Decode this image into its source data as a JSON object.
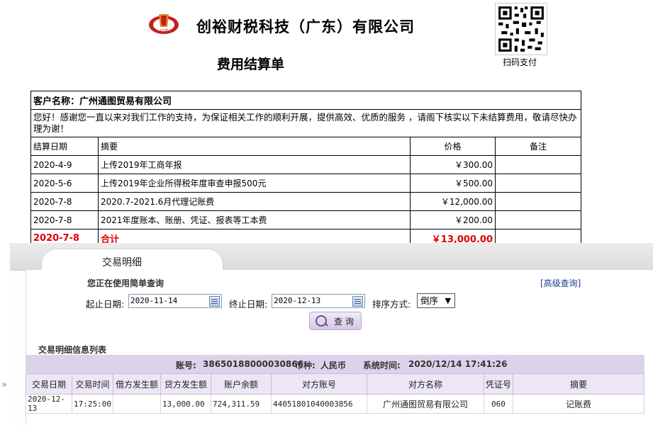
{
  "statement": {
    "company_name": "创裕财税科技（广东）有限公司",
    "doc_title": "费用结算单",
    "qr_label": "扫码支付",
    "customer_label": "客户名称：广州通图贸易有限公司",
    "message": "您好！感谢您一直以来对我们工作的支持，为保证相关工作的顺利开展，提供高效、优质的服务 ，请阁下核实以下未结算费用，敬请尽快办理为谢！",
    "headers": [
      "结算日期",
      "摘要",
      "价格",
      "备注"
    ],
    "rows": [
      {
        "date": "2020-4-9",
        "summary": "上传2019年工商年报",
        "price": "￥300.00",
        "note": ""
      },
      {
        "date": "2020-5-6",
        "summary": "上传2019年企业所得税年度审查申报500元",
        "price": "￥500.00",
        "note": ""
      },
      {
        "date": "2020-7-8",
        "summary": "2020.7-2021.6月代理记账费",
        "price": "￥12,000.00",
        "note": ""
      },
      {
        "date": "2020-7-8",
        "summary": "2021年度账本、账册、凭证、报表等工本费",
        "price": "￥200.00",
        "note": ""
      }
    ],
    "total": {
      "date": "2020-7-8",
      "summary": "合计",
      "price": "￥13,000.00"
    }
  },
  "txn": {
    "tab_label": "交易明细",
    "query_hint": "您正在使用简单查询",
    "advanced_link": "[高级查询]",
    "start_label": "起止日期:",
    "start_value": "2020-11-14",
    "end_label": "终止日期:",
    "end_value": "2020-12-13",
    "sort_label": "排序方式:",
    "sort_value": "倒序",
    "query_button": "查询",
    "list_title": "交易明细信息列表",
    "account_label": "账号:",
    "account_value": "38650188000030866",
    "currency_label": "币种:",
    "currency_value": "人民币",
    "systime_label": "系统时间:",
    "systime_value": "2020/12/14 17:41:26",
    "columns": [
      "交易日期",
      "交易时间",
      "借方发生额",
      "贷方发生额",
      "账户余额",
      "对方账号",
      "对方名称",
      "凭证号",
      "摘要"
    ],
    "rows": [
      [
        "2020-12-13",
        "17:25:00",
        "",
        "13,000.00",
        "724,311.59",
        "44051801040003856",
        "广州通图贸易有限公司",
        "060",
        "记账费"
      ]
    ],
    "side_arrow": "»"
  },
  "colors": {
    "total_red": "#e00000",
    "panel_purple": "#dcd2ea",
    "header_purple": "#ede6f5"
  }
}
